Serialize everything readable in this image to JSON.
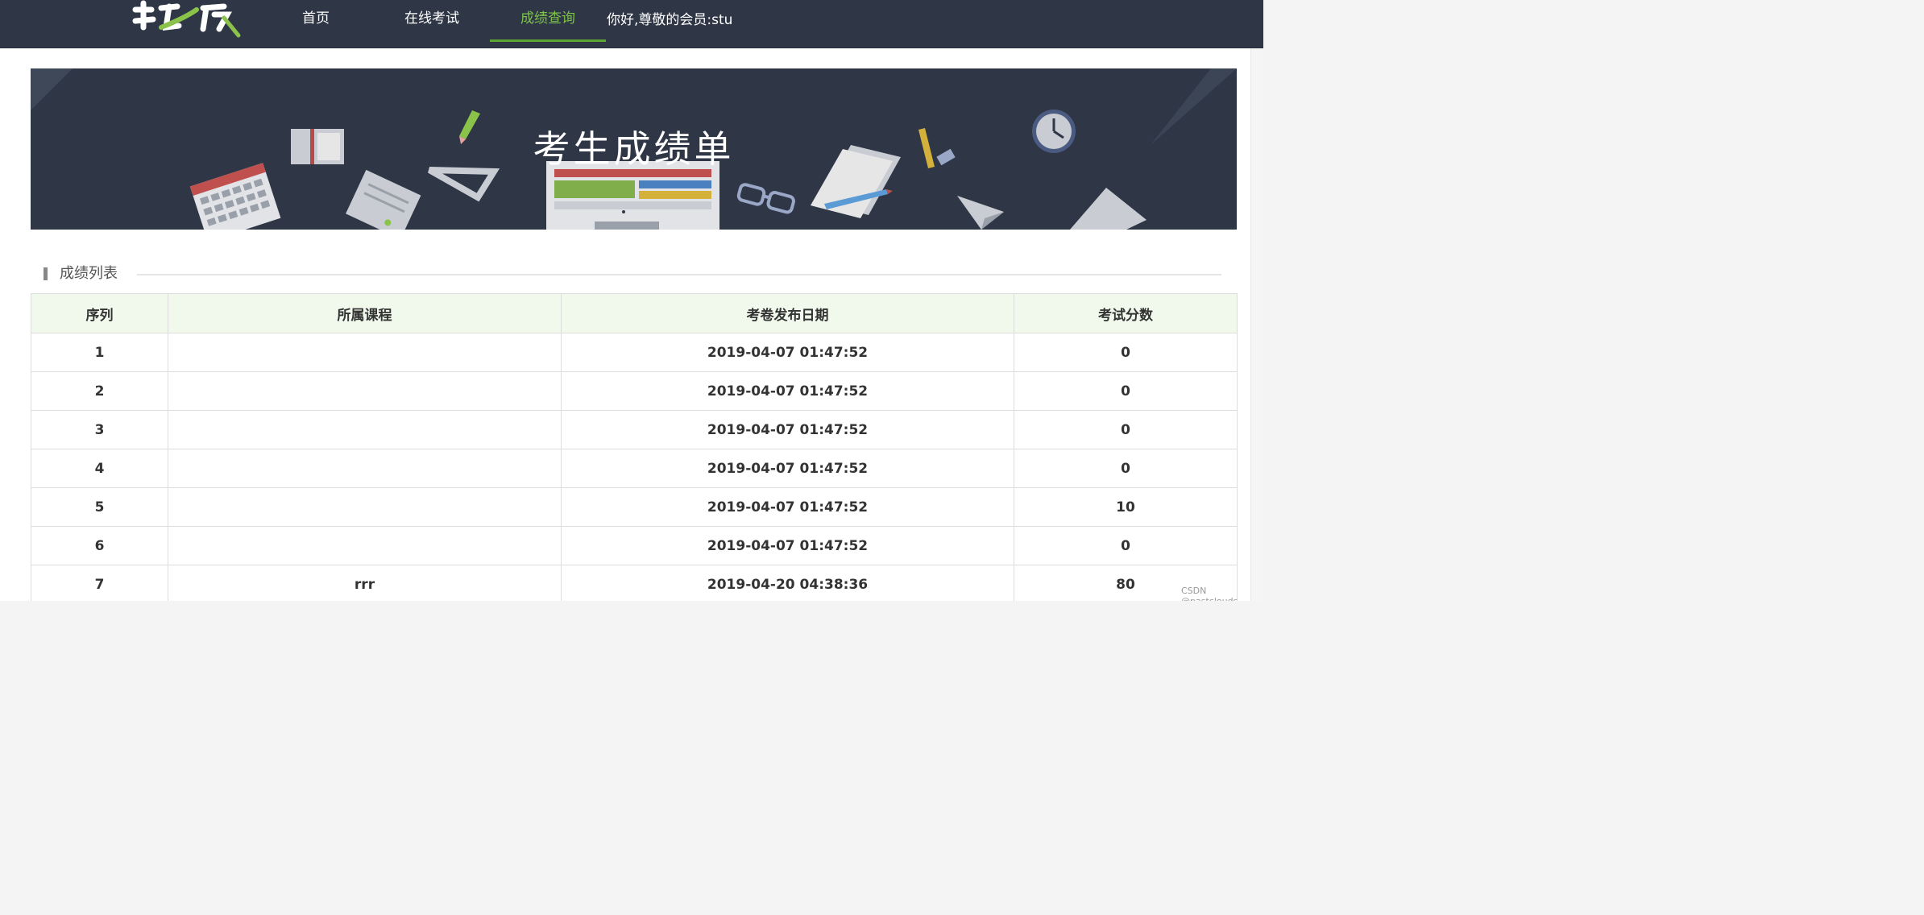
{
  "header": {
    "nav": [
      {
        "label": "首页"
      },
      {
        "label": "在线考试"
      },
      {
        "label": "成绩查询"
      }
    ],
    "greeting": "你好,尊敬的会员:stu"
  },
  "banner": {
    "title": "考生成绩单"
  },
  "section": {
    "title": "成绩列表"
  },
  "table": {
    "columns": [
      "序列",
      "所属课程",
      "考卷发布日期",
      "考试分数"
    ],
    "rows": [
      {
        "index": "1",
        "course": "",
        "date": "2019-04-07 01:47:52",
        "score": "0"
      },
      {
        "index": "2",
        "course": "",
        "date": "2019-04-07 01:47:52",
        "score": "0"
      },
      {
        "index": "3",
        "course": "",
        "date": "2019-04-07 01:47:52",
        "score": "0"
      },
      {
        "index": "4",
        "course": "",
        "date": "2019-04-07 01:47:52",
        "score": "0"
      },
      {
        "index": "5",
        "course": "",
        "date": "2019-04-07 01:47:52",
        "score": "10"
      },
      {
        "index": "6",
        "course": "",
        "date": "2019-04-07 01:47:52",
        "score": "0"
      },
      {
        "index": "7",
        "course": "rrr",
        "date": "2019-04-20 04:38:36",
        "score": "80"
      }
    ]
  },
  "watermark": "CSDN @pastclouds",
  "colors": {
    "header_bg": "#2f3747",
    "accent_green": "#7ec24c",
    "table_header_bg": "#f1f9ec"
  },
  "icons": {
    "logo": "brand-logo",
    "banner_illustrations": [
      "notebook-icon",
      "pencil-icon",
      "calendar-icon",
      "document-icon",
      "triangle-ruler-icon",
      "monitor-icon",
      "glasses-icon",
      "papers-icon",
      "clock-icon",
      "paper-plane-icon"
    ]
  }
}
